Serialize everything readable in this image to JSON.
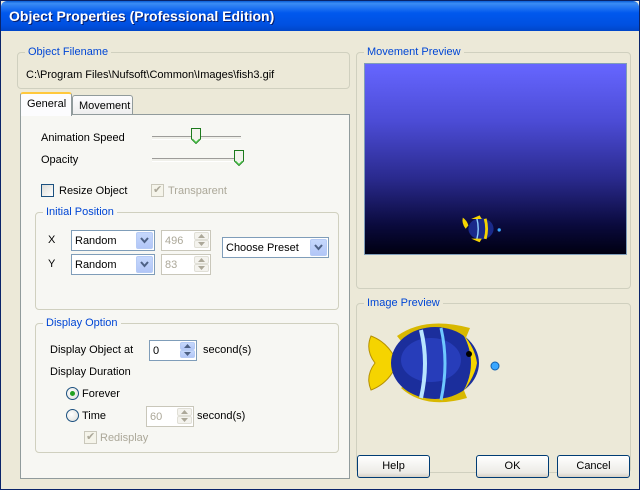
{
  "window": {
    "title": "Object Properties (Professional Edition)"
  },
  "object_filename": {
    "label": "Object Filename",
    "path": "C:\\Program Files\\Nufsoft\\Common\\Images\\fish3.gif"
  },
  "tabs": [
    {
      "label": "General",
      "active": true
    },
    {
      "label": "Movement",
      "active": false
    }
  ],
  "general": {
    "animation_speed": {
      "label": "Animation Speed",
      "level": 0.47
    },
    "opacity": {
      "label": "Opacity",
      "level": 1.0
    },
    "resize_object": {
      "label": "Resize Object",
      "checked": false
    },
    "transparent": {
      "label": "Transparent",
      "checked": true,
      "enabled": false
    }
  },
  "initial_position": {
    "label": "Initial Position",
    "x": {
      "label": "X",
      "mode": "Random",
      "value": "496"
    },
    "y": {
      "label": "Y",
      "mode": "Random",
      "value": "83"
    },
    "preset": "Choose Preset"
  },
  "display_option": {
    "label": "Display Option",
    "display_object_at": {
      "label": "Display Object at",
      "value": "0",
      "unit": "second(s)"
    },
    "display_duration_label": "Display Duration",
    "forever": {
      "label": "Forever",
      "selected": true
    },
    "time": {
      "label": "Time",
      "selected": false,
      "value": "60",
      "unit": "second(s)"
    },
    "redisplay": {
      "label": "Redisplay",
      "checked": true,
      "enabled": false
    }
  },
  "movement_preview": {
    "label": "Movement Preview"
  },
  "image_preview": {
    "label": "Image Preview"
  },
  "buttons": {
    "help": "Help",
    "ok": "OK",
    "cancel": "Cancel"
  },
  "colors": {
    "title_bar": "#0054e3",
    "group_label": "#0046d5",
    "check_green": "#21a121",
    "tab_highlight": "#ffc83c"
  }
}
